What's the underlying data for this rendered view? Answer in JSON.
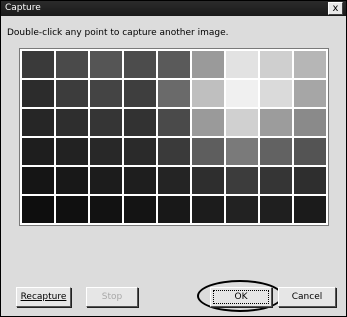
{
  "window": {
    "title": "Capture",
    "close_glyph": "x"
  },
  "instruction": "Double-click any point to capture another image.",
  "grid": {
    "rows": 6,
    "cols": 9,
    "shades": [
      [
        "#3a3a3a",
        "#4a4a4a",
        "#555555",
        "#4c4c4c",
        "#5a5a5a",
        "#9a9a9a",
        "#e2e2e2",
        "#cfcfcf",
        "#b6b6b6"
      ],
      [
        "#2c2c2c",
        "#3c3c3c",
        "#444444",
        "#3e3e3e",
        "#6a6a6a",
        "#bfbfbf",
        "#f0f0f0",
        "#dadada",
        "#a6a6a6"
      ],
      [
        "#262626",
        "#2e2e2e",
        "#353535",
        "#323232",
        "#4a4a4a",
        "#9a9a9a",
        "#d0d0d0",
        "#9c9c9c",
        "#8a8a8a"
      ],
      [
        "#1e1e1e",
        "#222222",
        "#282828",
        "#2a2a2a",
        "#3a3a3a",
        "#5e5e5e",
        "#7a7a7a",
        "#626262",
        "#545454"
      ],
      [
        "#151515",
        "#181818",
        "#1c1c1c",
        "#1e1e1e",
        "#242424",
        "#2e2e2e",
        "#3c3c3c",
        "#353535",
        "#2e2e2e"
      ],
      [
        "#0e0e0e",
        "#101010",
        "#121212",
        "#141414",
        "#181818",
        "#1c1c1c",
        "#222222",
        "#1f1f1f",
        "#1b1b1b"
      ]
    ]
  },
  "buttons": {
    "recapture": "Recapture",
    "stop": "Stop",
    "ok": "OK",
    "cancel": "Cancel"
  }
}
